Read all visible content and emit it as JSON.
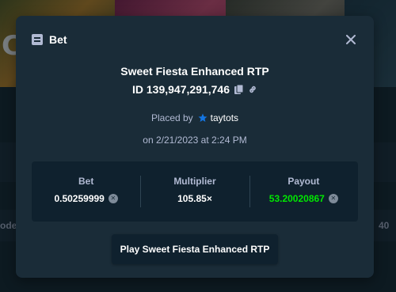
{
  "background": {
    "left_letter": "C",
    "left_text": "ode",
    "right_number": "40"
  },
  "modal": {
    "title": "Bet",
    "icons": {
      "header": "receipt-icon",
      "close": "close-icon",
      "copy": "copy-icon",
      "link": "link-icon",
      "star": "star-icon",
      "currency": "currency-icon"
    },
    "game_name": "Sweet Fiesta Enhanced RTP",
    "bet_id": "ID 139,947,291,746",
    "placed_by_label": "Placed by",
    "username": "taytots",
    "date": "on 2/21/2023 at 2:24 PM",
    "stats": {
      "bet_label": "Bet",
      "bet_value": "0.50259999",
      "multiplier_label": "Multiplier",
      "multiplier_value": "105.85×",
      "payout_label": "Payout",
      "payout_value": "53.20020867"
    },
    "play_button": "Play Sweet Fiesta Enhanced RTP"
  },
  "colors": {
    "modal_bg": "#1a2c38",
    "box_bg": "#0f212e",
    "text_muted": "#b1bad3",
    "payout_green": "#00e701",
    "star_blue": "#1475e1"
  }
}
